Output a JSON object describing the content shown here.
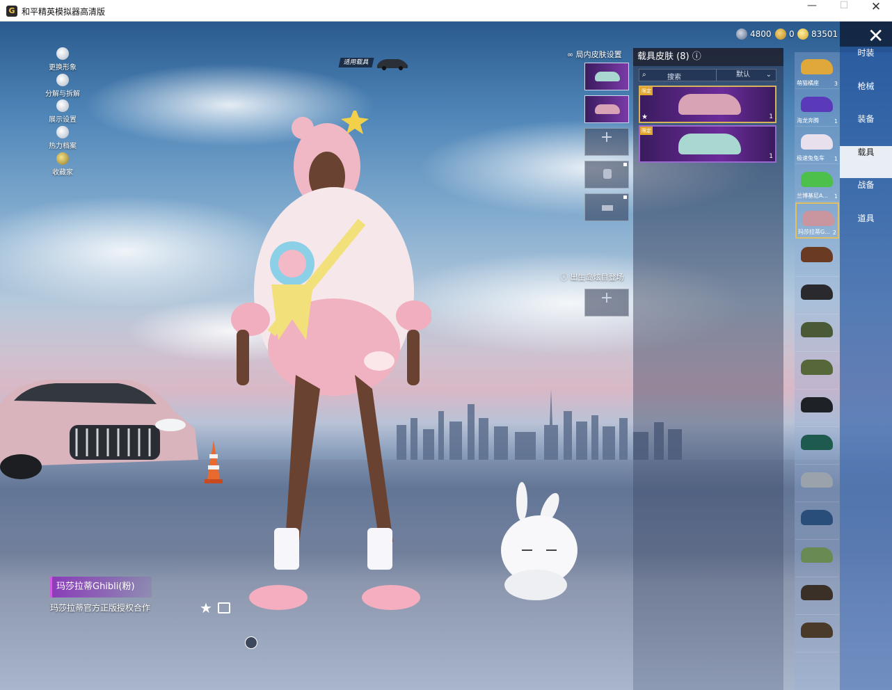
{
  "window": {
    "title": "和平精英模拟器高清版",
    "app_icon_glyph": "G"
  },
  "currency": [
    {
      "icon": "silver-coin-icon",
      "value": "4800"
    },
    {
      "icon": "gold-token-icon",
      "value": "0"
    },
    {
      "icon": "gold-coin-icon",
      "value": "83501"
    }
  ],
  "left_menu": [
    {
      "label": "更换形象",
      "icon": "avatar-icon"
    },
    {
      "label": "分解与拆解",
      "icon": "puzzle-icon"
    },
    {
      "label": "展示设置",
      "icon": "eye-icon"
    },
    {
      "label": "热力档案",
      "icon": "flame-icon"
    },
    {
      "label": "收藏家",
      "icon": "collector-badge-icon"
    }
  ],
  "apply_vehicle_label": "适用载具",
  "slots": {
    "label": "局内皮肤设置",
    "debut_label": "出生岛炫目登场"
  },
  "skin_panel": {
    "title": "载具皮肤 (8)",
    "search_label": "搜索",
    "sort_label": "默认",
    "cards": [
      {
        "tag": "限定",
        "color": "#d8a3b5"
      },
      {
        "tag": "限定",
        "color": "#a8d8d0"
      }
    ],
    "card_count": "1"
  },
  "vehicles": [
    {
      "name": "萌猫橘座",
      "count": "3",
      "color": "#e0a83a"
    },
    {
      "name": "海龙奔腾",
      "count": "1",
      "color": "#5a3ab8"
    },
    {
      "name": "极速兔兔车",
      "count": "1",
      "color": "#e8e0ec"
    },
    {
      "name": "兰博基尼A...",
      "count": "1",
      "color": "#4cc04a"
    },
    {
      "name": "玛莎拉蒂G...",
      "count": "2",
      "color": "#c9959e"
    },
    {
      "name": "",
      "count": "",
      "color": "#6a3b22"
    },
    {
      "name": "",
      "count": "",
      "color": "#2a2a2e"
    },
    {
      "name": "",
      "count": "",
      "color": "#4a5a36"
    },
    {
      "name": "",
      "count": "",
      "color": "#56683a"
    },
    {
      "name": "",
      "count": "",
      "color": "#1e2226"
    },
    {
      "name": "",
      "count": "",
      "color": "#1f5a4e"
    },
    {
      "name": "",
      "count": "",
      "color": "#9aa2ac"
    },
    {
      "name": "",
      "count": "",
      "color": "#2a4e7a"
    },
    {
      "name": "",
      "count": "",
      "color": "#6a8a54"
    },
    {
      "name": "",
      "count": "",
      "color": "#3a3028"
    },
    {
      "name": "",
      "count": "",
      "color": "#4a3a2a"
    }
  ],
  "right_nav": [
    "时装",
    "枪械",
    "装备",
    "载具",
    "战备",
    "道具"
  ],
  "right_nav_active": "载具",
  "item": {
    "name": "玛莎拉蒂Ghibli(粉)",
    "description": "玛莎拉蒂官方正版授权合作"
  },
  "accent_colors": {
    "rarity_gold": "#d8b35a",
    "legend_purple": "#6b2c9a",
    "nav_active_bg": "#e9eef5"
  }
}
